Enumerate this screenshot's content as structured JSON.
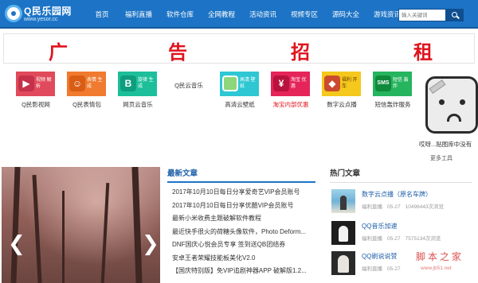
{
  "header": {
    "logo_text": "Q民乐园网",
    "logo_url": "www.yesor.cc",
    "nav": [
      "首页",
      "福利直播",
      "软件仓库",
      "全网教程",
      "活动资讯",
      "视频专区",
      "源码大全",
      "游戏资讯"
    ],
    "search_placeholder": "输入关键词"
  },
  "banner": {
    "chars": [
      "广",
      "告",
      "招",
      "租"
    ],
    "color": "#e0141e"
  },
  "apps": [
    {
      "label": "Q民影视网",
      "tile_text": "视频 解析",
      "symbol": "▶",
      "bg": "#e04a5b",
      "sym_bg": "#c5314a",
      "icon": "video-icon"
    },
    {
      "label": "Q民表情包",
      "tile_text": "表情 生成",
      "symbol": "☺",
      "bg": "#f07a2f",
      "sym_bg": "#d95d15",
      "icon": "emoji-icon"
    },
    {
      "label": "网页云音乐",
      "tile_text": "旋律 生成",
      "symbol": "B",
      "bg": "#1dbf9a",
      "sym_bg": "#0f9d7e",
      "icon": "music-icon"
    },
    {
      "label": "Q民云音乐",
      "tile_text": "",
      "symbol": "",
      "bg": "#ffffff",
      "sym_bg": "#ffffff",
      "icon": "none"
    },
    {
      "label": "高清云壁纸",
      "tile_text": "高清 壁纸",
      "symbol": "",
      "bg": "#2ec7d3",
      "sym_bg": "#8ed67a",
      "icon": "wallpaper-icon"
    },
    {
      "label": "淘宝内部优惠",
      "tile_text": "淘宝 优惠",
      "symbol": "¥",
      "bg": "#e5245a",
      "sym_bg": "#b8123f",
      "icon": "coupon-icon"
    },
    {
      "label": "数字云点播",
      "tile_text": "福利 开车",
      "symbol": "◆",
      "bg": "#f4c81c",
      "sym_bg": "#ca4b2f",
      "icon": "play-icon"
    },
    {
      "label": "短信轰炸服务",
      "tile_text": "短信 轰炸",
      "symbol": "SMS",
      "bg": "#26b45e",
      "sym_bg": "#0f8a3c",
      "icon": "sms-icon"
    }
  ],
  "sidecard": {
    "text": "哎呀...贴图库中没有",
    "link": "更多工具"
  },
  "slider": {
    "prev": "❮",
    "next": "❯"
  },
  "latest": {
    "title": "最新文章",
    "items": [
      "2017年10月10日每日分享爱奇艺VIP会员账号",
      "2017年10月10日每日分享优酷VIP会员账号",
      "最新小米收费主题破解软件教程",
      "最近快手很火的荷糖头像软件，Photo Deform...",
      "DNF国庆心悦会员专享 签到送QB团结券",
      "安卓王者荣耀技能板美化V2.0",
      "【国庆特别版】免VIP追剧神器APP 破解版1.2..."
    ]
  },
  "hot": {
    "title": "热门文章",
    "items": [
      {
        "name": "数字云点播（原名车牌）",
        "cat": "福利直播",
        "date": "05-27",
        "views": "10496443次浏览"
      },
      {
        "name": "QQ音乐加速",
        "cat": "福利直播",
        "date": "05-27",
        "views": "7575134次浏览"
      },
      {
        "name": "QQ刷说说赞",
        "cat": "福利直播",
        "date": "05-27",
        "views": ""
      }
    ]
  },
  "watermark": {
    "text": "脚 本 之 家",
    "url": "www.jb51.net"
  }
}
